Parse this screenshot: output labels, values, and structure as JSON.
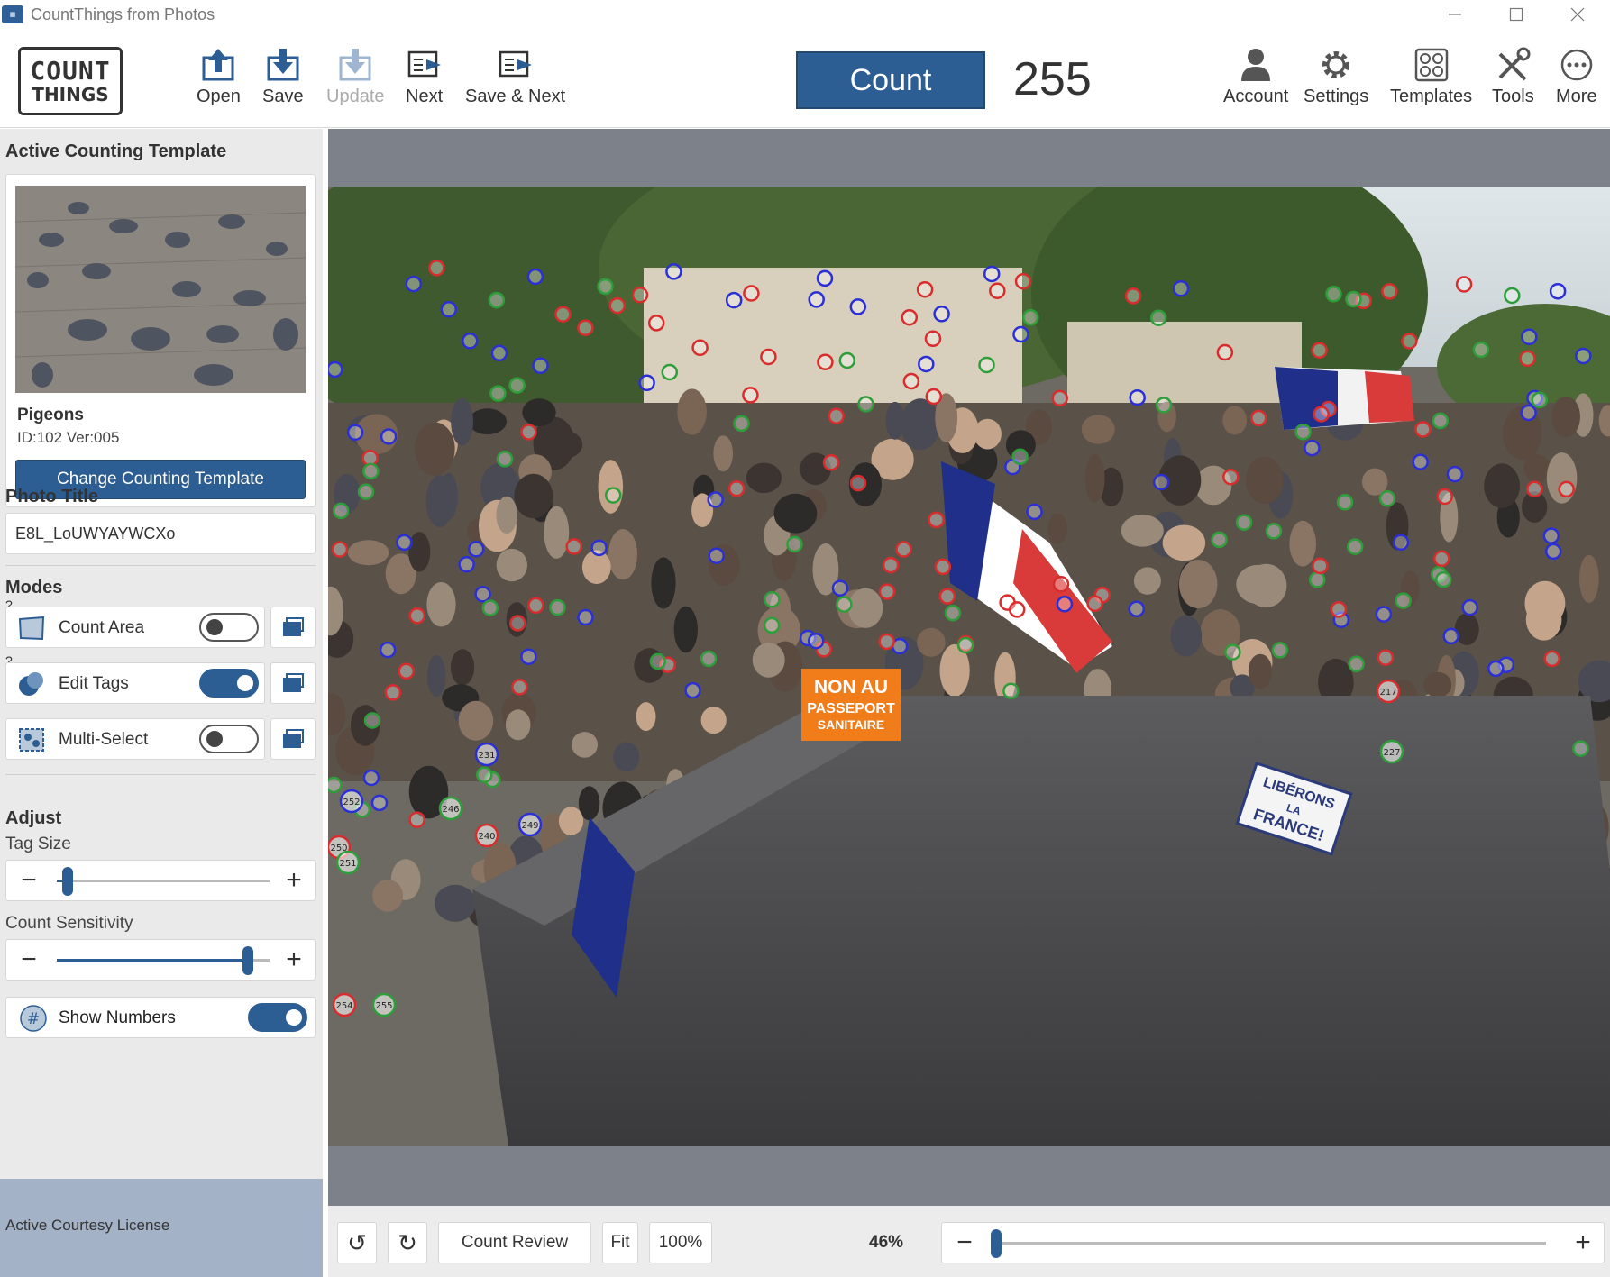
{
  "window": {
    "title": "CountThings from Photos",
    "app_icon_text": "COUNT\nTHINGS"
  },
  "logo": {
    "line1": "COUNT",
    "line2": "THINGS"
  },
  "toolbar": {
    "open_label": "Open",
    "save_label": "Save",
    "update_label": "Update",
    "next_label": "Next",
    "save_next_label": "Save & Next",
    "count_label": "Count",
    "count_value": "255",
    "account_label": "Account",
    "settings_label": "Settings",
    "templates_label": "Templates",
    "tools_label": "Tools",
    "more_label": "More"
  },
  "sidebar": {
    "template_section_title": "Active Counting Template",
    "template_name": "Pigeons",
    "template_id": "ID:102 Ver:005",
    "change_template_label": "Change Counting Template",
    "photo_title_heading": "Photo Title",
    "photo_title_value": "E8L_LoUWYAYWCXo",
    "modes_heading": "Modes",
    "modes": [
      {
        "label": "Count Area",
        "on": false
      },
      {
        "label": "Edit Tags",
        "on": true
      },
      {
        "label": "Multi-Select",
        "on": false
      }
    ],
    "help_mark": "?",
    "adjust_heading": "Adjust",
    "tag_size_label": "Tag Size",
    "tag_size_level": 0.05,
    "count_sensitivity_label": "Count Sensitivity",
    "count_sensitivity_level": 0.9,
    "show_numbers_label": "Show Numbers",
    "show_numbers_on": true,
    "minus": "−",
    "plus": "+",
    "license_label": "Active Courtesy License"
  },
  "photo": {
    "sign_orange": [
      "NON AU",
      "PASSEPORT",
      "SANITAIRE"
    ],
    "sign_white": [
      "LIBÉRONS",
      "LA",
      "FRANCE!"
    ],
    "visible_tag_numbers": [
      "217",
      "227",
      "231",
      "240",
      "246",
      "249",
      "250",
      "251",
      "252",
      "254",
      "255"
    ]
  },
  "bottombar": {
    "rotate_left": "↺",
    "rotate_right": "↻",
    "count_review_label": "Count Review",
    "fit_label": "Fit",
    "zoom_100_label": "100%",
    "zoom_value": "46%",
    "zoom_level": 0.0,
    "minus": "−",
    "plus": "+"
  },
  "colors": {
    "accent": "#2d5e93",
    "tag_red": "#d92c2c",
    "tag_green": "#2e9e3a",
    "tag_blue": "#2b2fd6"
  }
}
